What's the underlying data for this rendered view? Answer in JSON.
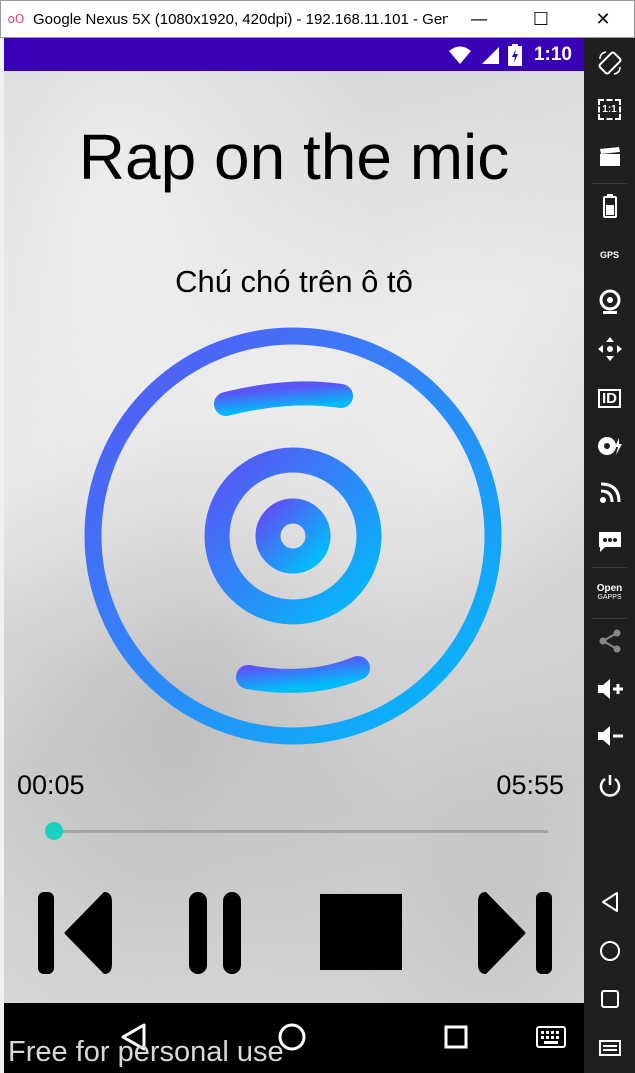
{
  "window": {
    "title": "Google Nexus 5X (1080x1920, 420dpi) - 192.168.11.101 - Gen...",
    "minimize": "—",
    "maximize": "☐",
    "close": "✕"
  },
  "statusbar": {
    "time": "1:10",
    "icons": [
      "wifi-icon",
      "signal-icon",
      "battery-charging-icon"
    ]
  },
  "app": {
    "title": "Rap on the mic",
    "song_title": "Chú chó trên ô tô",
    "current_time": "00:05",
    "total_time": "05:55",
    "progress_fraction": 0.015,
    "controls": [
      "previous-icon",
      "pause-icon",
      "stop-icon",
      "next-icon"
    ],
    "colors": {
      "disc_start": "#5a55f5",
      "disc_end": "#00bdfa",
      "seek": "#1ad1c0",
      "statusbar": "#3a00b5"
    }
  },
  "navbar": {
    "buttons": [
      "back-icon",
      "home-icon",
      "recents-icon",
      "keyboard-icon"
    ]
  },
  "watermark": "Free for personal use",
  "sidebar": {
    "items": [
      "rotate-icon",
      "fit-screen-icon",
      "screenshot-icon",
      "battery-icon",
      "gps-icon",
      "camera-icon",
      "dpad-icon",
      "id-icon",
      "media-icon",
      "rss-icon",
      "sms-icon",
      "open-gapps-icon",
      "share-icon",
      "volume-up-icon",
      "volume-down-icon",
      "power-icon",
      "back-icon",
      "home-icon",
      "recents-icon",
      "menu-icon"
    ],
    "gps_label": "GPS",
    "id_label": "ID",
    "fit_label": "1:1",
    "gapps_label_1": "Open",
    "gapps_label_2": "GAPPS"
  }
}
